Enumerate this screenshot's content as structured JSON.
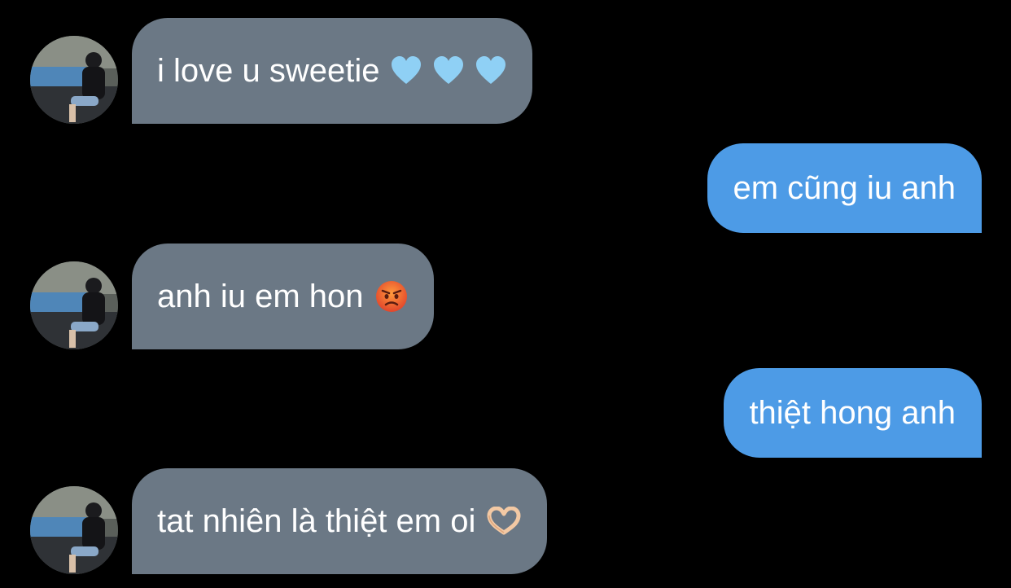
{
  "conversation": {
    "messages": [
      {
        "side": "incoming",
        "text": "i love u sweetie",
        "emoji": [
          "light-blue-heart",
          "light-blue-heart",
          "light-blue-heart"
        ]
      },
      {
        "side": "outgoing",
        "text": "em cũng iu anh",
        "emoji": []
      },
      {
        "side": "incoming",
        "text": "anh iu em hon",
        "emoji": [
          "angry-face"
        ]
      },
      {
        "side": "outgoing",
        "text": "thiệt hong anh",
        "emoji": []
      },
      {
        "side": "incoming",
        "text": "tat nhiên là thiệt em oi",
        "emoji": [
          "heart-hands"
        ]
      }
    ]
  },
  "colors": {
    "background": "#000000",
    "incoming_bubble": "#6b7885",
    "outgoing_bubble": "#4d9be6",
    "text": "#ffffff",
    "heart": "#8fd0f5"
  }
}
